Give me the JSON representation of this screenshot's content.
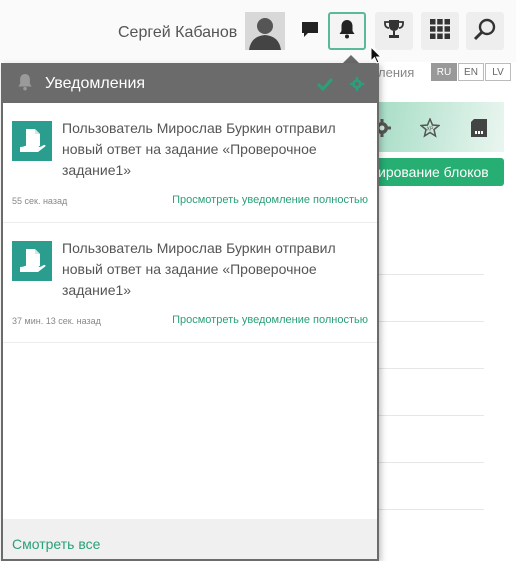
{
  "header": {
    "user_name": "Сергей Кабанов",
    "icons": [
      "avatar",
      "chat-icon",
      "bell-icon",
      "trophy-icon",
      "grid-icon",
      "search-icon"
    ]
  },
  "background": {
    "breadcrumb_partial": "ления",
    "languages": [
      "RU",
      "EN",
      "LV"
    ],
    "active_language": "RU",
    "green_button_partial": "ирование блоков"
  },
  "notifications": {
    "title": "Уведомления",
    "items": [
      {
        "text": "Пользователь Мирослав Буркин отправил новый ответ на задание «Проверочное задание1»",
        "time": "55 сек. назад",
        "link": "Просмотреть уведомление полностью"
      },
      {
        "text": "Пользователь Мирослав Буркин отправил новый ответ на задание «Проверочное задание1»",
        "time": "37 мин. 13 сек. назад",
        "link": "Просмотреть уведомление полностью"
      }
    ],
    "see_all": "Смотреть все"
  },
  "colors": {
    "accent_green": "#2aa07a",
    "header_gray": "#6b6b6b",
    "icon_teal": "#2a9d8f",
    "button_green": "#27ae73"
  }
}
